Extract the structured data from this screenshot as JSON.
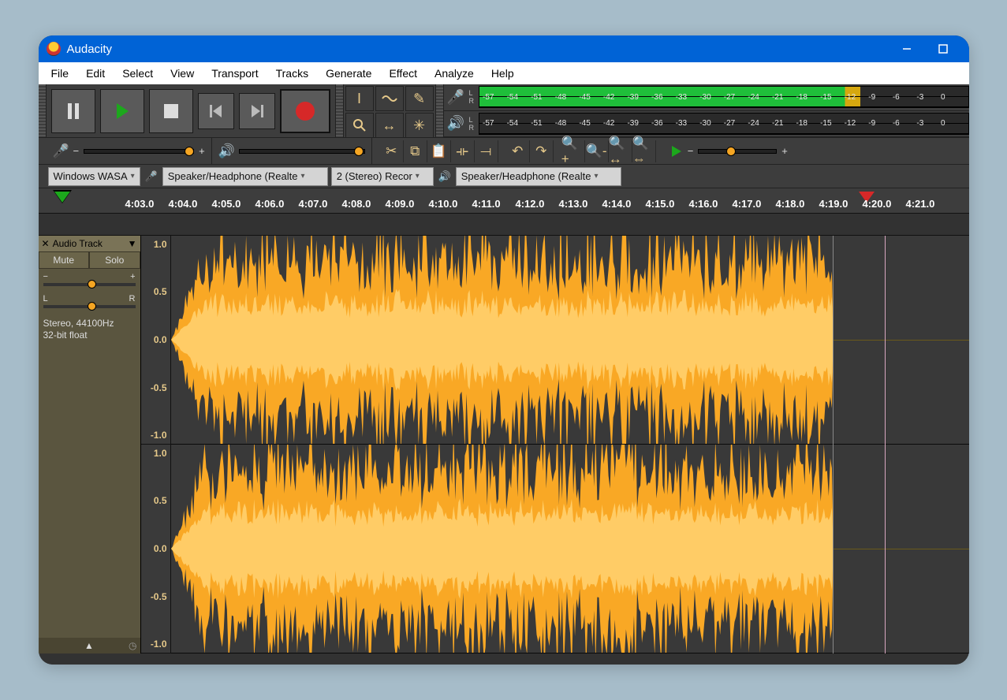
{
  "window": {
    "title": "Audacity"
  },
  "menu": [
    "File",
    "Edit",
    "Select",
    "View",
    "Transport",
    "Tracks",
    "Generate",
    "Effect",
    "Analyze",
    "Help"
  ],
  "meter_ticks": [
    "-57",
    "-54",
    "-51",
    "-48",
    "-45",
    "-42",
    "-39",
    "-36",
    "-33",
    "-30",
    "-27",
    "-24",
    "-21",
    "-18",
    "-15",
    "-12",
    "-9",
    "-6",
    "-3",
    "0"
  ],
  "meter_lr": {
    "l": "L",
    "r": "R"
  },
  "devices": {
    "host": "Windows WASA",
    "rec_device": "Speaker/Headphone (Realte",
    "channels": "2 (Stereo) Recor",
    "play_device": "Speaker/Headphone (Realte"
  },
  "timeline": {
    "ticks": [
      "4:03.0",
      "4:04.0",
      "4:05.0",
      "4:06.0",
      "4:07.0",
      "4:08.0",
      "4:09.0",
      "4:10.0",
      "4:11.0",
      "4:12.0",
      "4:13.0",
      "4:14.0",
      "4:15.0",
      "4:16.0",
      "4:17.0",
      "4:18.0",
      "4:19.0",
      "4:20.0",
      "4:21.0"
    ]
  },
  "track": {
    "name": "Audio Track",
    "mute": "Mute",
    "solo": "Solo",
    "gain_minus": "−",
    "gain_plus": "+",
    "pan_l": "L",
    "pan_r": "R",
    "info1": "Stereo, 44100Hz",
    "info2": "32-bit float"
  },
  "scale": {
    "p10": "1.0",
    "p05": "0.5",
    "z": "0.0",
    "n05": "-0.5",
    "n10": "-1.0"
  },
  "colors": {
    "wave_fill": "#f9a825",
    "wave_core": "#ffcc66",
    "meter_green": "#1fbf3a",
    "meter_end": "#d6a80f"
  }
}
